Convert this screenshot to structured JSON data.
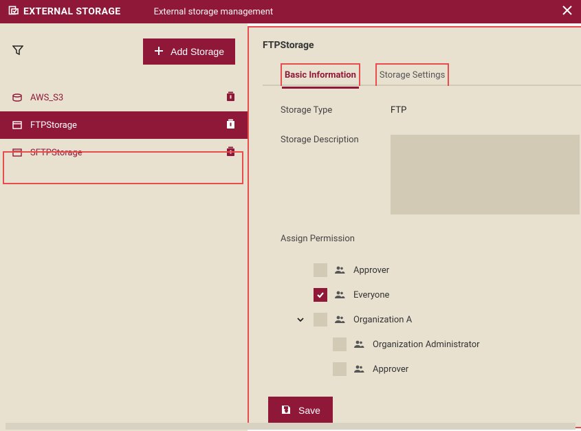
{
  "header": {
    "title": "EXTERNAL STORAGE",
    "subtitle": "External storage management"
  },
  "toolbar": {
    "add_label": "Add Storage"
  },
  "storages": [
    {
      "label": "AWS_S3",
      "selected": false
    },
    {
      "label": "FTPStorage",
      "selected": true
    },
    {
      "label": "SFTPStorage",
      "selected": false
    }
  ],
  "panel": {
    "title": "FTPStorage",
    "tabs": {
      "basic": "Basic Information",
      "settings": "Storage Settings"
    },
    "fields": {
      "type_label": "Storage Type",
      "type_value": "FTP",
      "desc_label": "Storage Description",
      "desc_value": "",
      "perm_label": "Assign Permission"
    },
    "permissions": [
      {
        "label": "Approver",
        "checked": false
      },
      {
        "label": "Everyone",
        "checked": true
      },
      {
        "label": "Organization A",
        "checked": false,
        "expandable": true,
        "children": [
          {
            "label": "Organization Administrator",
            "checked": false
          },
          {
            "label": "Approver",
            "checked": false
          }
        ]
      }
    ],
    "save_label": "Save"
  }
}
